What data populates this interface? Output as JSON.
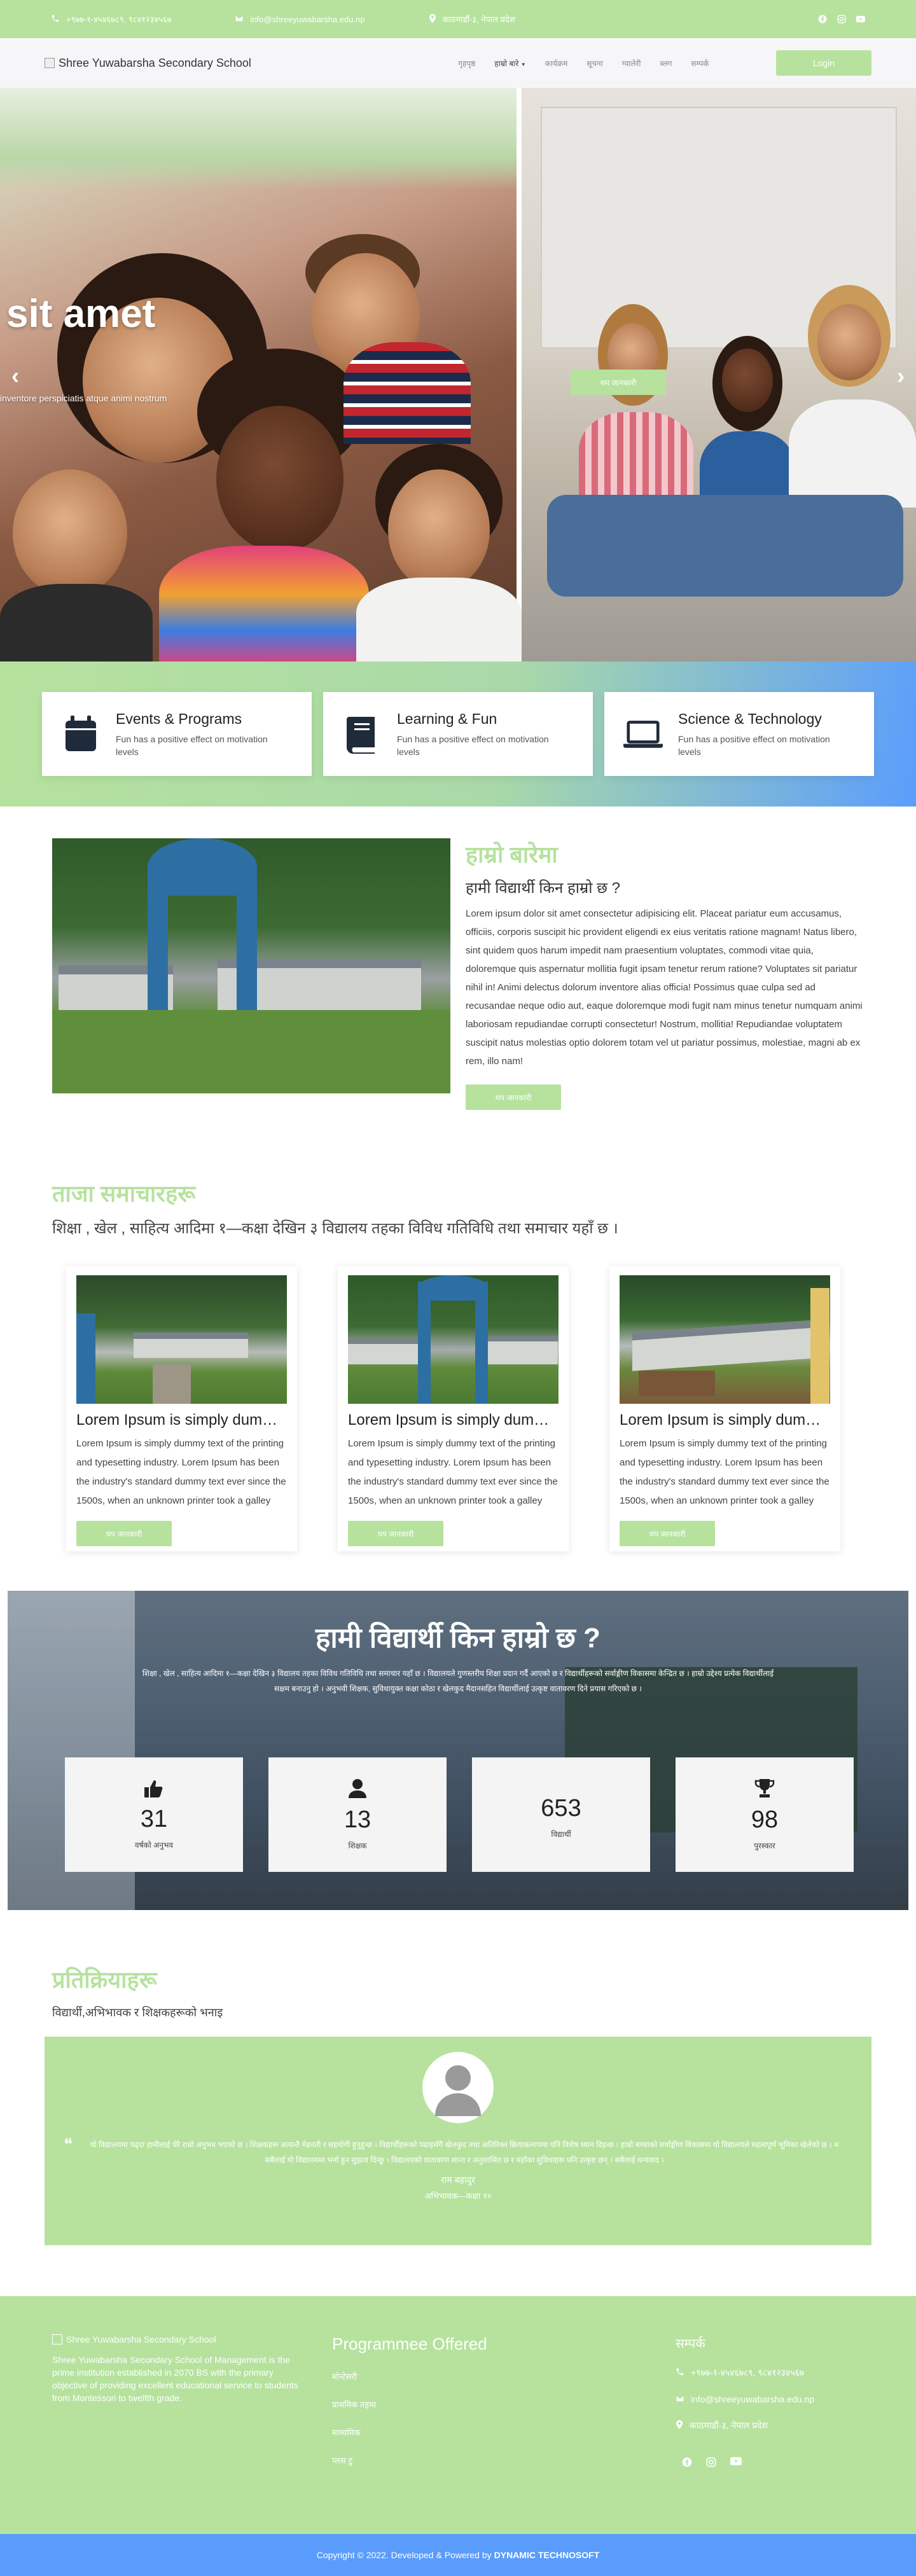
{
  "topbar": {
    "phone": "+९७७-१-४५४६७८९, ९८४१२३४५६७",
    "email": "info@shreeyuwabarsha.edu.np",
    "address": "काठमाडौं-३, नेपाल प्रदेश"
  },
  "nav": {
    "logo_alt": "Shree Yuwabarsha Secondary School",
    "items": [
      "गृहपृष्ठ",
      "हाम्रो बारे",
      "कार्यक्रम",
      "सूचना",
      "ग्यालेरी",
      "ब्लग",
      "सम्पर्क"
    ],
    "dropdown_index": 1,
    "login": "Login"
  },
  "hero": {
    "title": "sit amet",
    "subtitle": "inventore perspiciatis atque animi nostrum",
    "button": "थप जानकारी"
  },
  "features": [
    {
      "title": "Events & Programs",
      "text": "Fun has a positive effect on motivation levels",
      "icon": "calendar-icon"
    },
    {
      "title": "Learning & Fun",
      "text": "Fun has a positive effect on motivation levels",
      "icon": "book-icon"
    },
    {
      "title": "Science & Technology",
      "text": "Fun has a positive effect on motivation levels",
      "icon": "laptop-icon"
    }
  ],
  "about": {
    "title": "हाम्रो बारेमा",
    "question": "हामी विद्यार्थी किन हाम्रो छ ?",
    "text": "Lorem ipsum dolor sit amet consectetur adipisicing elit. Placeat pariatur eum accusamus, officiis, corporis suscipit hic provident eligendi ex eius veritatis ratione magnam! Natus libero, sint quidem quos harum impedit nam praesentium voluptates, commodi vitae quia, doloremque quis aspernatur mollitia fugit ipsam tenetur rerum ratione? Voluptates sit pariatur nihil in! Animi delectus dolorum inventore alias officia! Possimus quae culpa sed ad recusandae neque odio aut, eaque doloremque modi fugit nam minus tenetur numquam animi laboriosam repudiandae corrupti consectetur! Nostrum, mollitia! Repudiandae voluptatem suscipit natus molestias optio dolorem totam vel ut pariatur possimus, molestiae, magni ab ex rem, illo nam!",
    "button": "थप जानकारी"
  },
  "news": {
    "title": "ताजा समाचारहरू",
    "subtitle": "शिक्षा , खेल , साहित्य आदिमा १—कक्षा देखिन ३ विद्यालय तहका विविध गतिविधि तथा समाचार यहाँ छ ।",
    "cards": [
      {
        "title": "Lorem Ipsum is simply dummy text",
        "text": "Lorem Ipsum is simply dummy text of the printing and typesetting industry. Lorem Ipsum has been the industry's standard dummy text ever since the 1500s, when an unknown printer took a galley",
        "button": "थप जानकारी"
      },
      {
        "title": "Lorem Ipsum is simply dummy text",
        "text": "Lorem Ipsum is simply dummy text of the printing and typesetting industry. Lorem Ipsum has been the industry's standard dummy text ever since the 1500s, when an unknown printer took a galley",
        "button": "थप जानकारी"
      },
      {
        "title": "Lorem Ipsum is simply dummy text",
        "text": "Lorem Ipsum is simply dummy text of the printing and typesetting industry. Lorem Ipsum has been the industry's standard dummy text ever since the 1500s, when an unknown printer took a galley",
        "button": "थप जानकारी"
      }
    ]
  },
  "stats": {
    "title": "हामी विद्यार्थी किन हाम्रो छ ?",
    "desc": "शिक्षा , खेल , साहित्य आदिमा १—कक्षा देखिन ३ विद्यालय तहका विविध गतिविधि तथा समाचार यहाँ छ । विद्यालयले गुणस्तरीय शिक्षा प्रदान गर्दै आएको छ र विद्यार्थीहरूको सर्वाङ्गीण विकासमा केन्द्रित छ । हाम्रो उद्देश्य प्रत्येक विद्यार्थीलाई सक्षम बनाउनु हो । अनुभवी शिक्षक, सुविधायुक्त कक्षा कोठा र खेलकुद मैदानसहित विद्यार्थीलाई उत्कृष्ट वातावरण दिने प्रयास गरिएको छ ।",
    "items": [
      {
        "icon": "thumbs-up-icon",
        "value": "31",
        "label": "वर्षको अनुभव"
      },
      {
        "icon": "user-icon",
        "value": "13",
        "label": "शिक्षक"
      },
      {
        "icon": "",
        "value": "653",
        "label": "विद्यार्थी"
      },
      {
        "icon": "trophy-icon",
        "value": "98",
        "label": "पुरस्कार"
      }
    ]
  },
  "testimonial": {
    "title": "प्रतिक्रियाहरू",
    "subtitle": "विद्यार्थी,अभिभावक र शिक्षकहरूको भनाइ",
    "quote": "यो विद्यालयमा पढ्दा हामीलाई धेरै राम्रो अनुभव भएको छ । शिक्षकहरू अत्यन्तै मेहनती र सहयोगी हुनुहुन्छ । विद्यार्थीहरूको पढाइसँगै खेलकुद तथा अतिरिक्त क्रियाकलापमा पनि विशेष ध्यान दिइन्छ । हाम्रो बच्चाको सर्वाङ्गीण विकासमा यो विद्यालयले महत्वपूर्ण भूमिका खेलेको छ । म सबैलाई यो विद्यालयमा भर्ना हुन सुझाव दिन्छु । विद्यालयको वातावरण शान्त र अनुशासित छ र यहाँका सुविधाहरू पनि उत्कृष्ट छन् । सबैलाई धन्यवाद ।",
    "name": "राम बहादुर",
    "role": "अभिभावक—कक्षा १०"
  },
  "footer": {
    "logo_alt": "Shree Yuwabarsha Secondary School",
    "about": "Shree Yuwabarsha Secondary School of Management is the prime institution established in 2070 BS with the primary objective of providing excellent educational service to students from Montessori to twelfth grade.",
    "programs_title": "Programmee Offered",
    "programs": [
      "मोन्टेसरी",
      "प्राथमिक तहमा",
      "माध्यमिक",
      "प्लस टु"
    ],
    "contact_title": "सम्पर्क",
    "phone": "+९७७-१-४५४६७८९, ९८४१२३४५६७",
    "email": "info@shreeyuwabarsha.edu.np",
    "address": "काठमाडौं-३, नेपाल प्रदेश"
  },
  "copyright": {
    "text": "Copyright © 2022. Developed & Powered by",
    "brand": "DYNAMIC TECHNOSOFT"
  },
  "colors": {
    "accent": "#b6e29e",
    "copyright_bg": "#5a9cfc"
  }
}
